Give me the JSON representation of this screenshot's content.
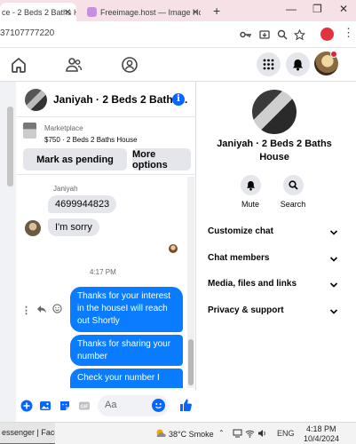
{
  "browser": {
    "tab1_title": "ce - 2 Beds 2 Baths H",
    "tab2_title": "Freeimage.host — Image Hosti",
    "url": "37107777220"
  },
  "chat": {
    "contact_name": "Janiyah · 2 Beds 2 Baths...",
    "marketplace_label": "Marketplace",
    "listing": "$750 · 2 Beds 2 Baths House",
    "mark_pending": "Mark as pending",
    "more_options": "More options",
    "sender": "Janiyah",
    "incoming": [
      "4699944823",
      "I'm sorry"
    ],
    "time": "4:17 PM",
    "outgoing": [
      "Thanks for your interest in the houseI will reach out Shortly",
      "Thanks for  sharing your number",
      "Check your number  I"
    ],
    "composer_placeholder": "Aa"
  },
  "info": {
    "name_line1": "Janiyah · 2 Beds 2 Baths",
    "name_line2": "House",
    "mute": "Mute",
    "search": "Search",
    "menu": [
      "Customize chat",
      "Chat members",
      "Media, files and links",
      "Privacy & support"
    ]
  },
  "taskbar": {
    "app": "essenger | Facebo...",
    "weather": "38°C  Smoke",
    "lang": "ENG",
    "time": "4:18 PM",
    "date": "10/4/2024"
  },
  "colors": {
    "messenger_blue": "#0a7cff",
    "fb_blue": "#0866ff",
    "light_gray": "#e4e6eb"
  }
}
